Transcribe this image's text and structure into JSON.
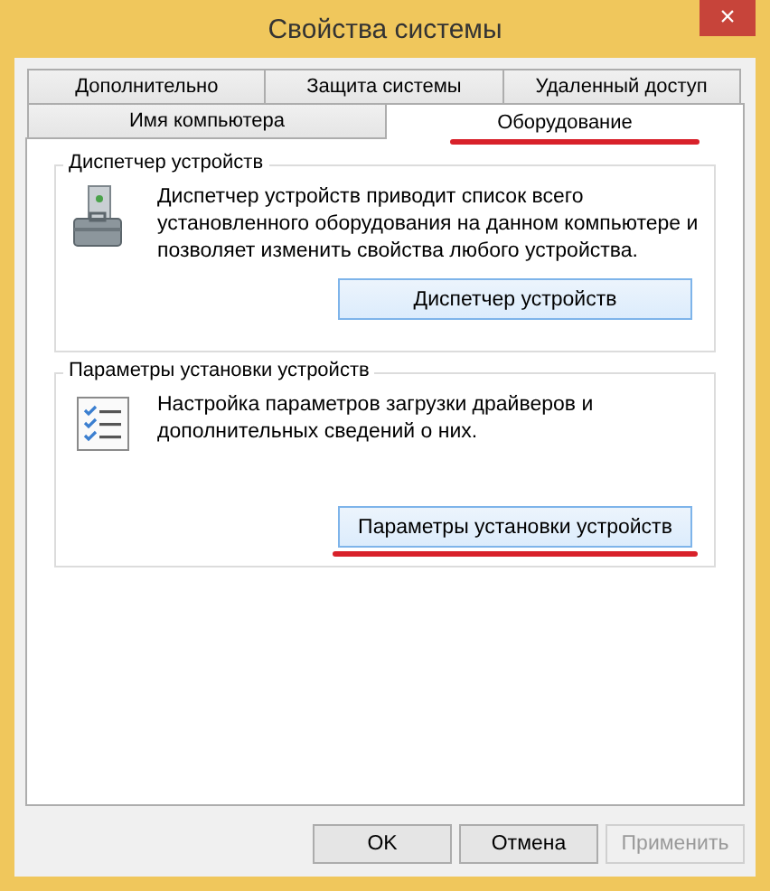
{
  "window": {
    "title": "Свойства системы",
    "close": "×"
  },
  "tab_rows": [
    [
      {
        "label": "Дополнительно",
        "selected": false
      },
      {
        "label": "Защита системы",
        "selected": false
      },
      {
        "label": "Удаленный доступ",
        "selected": false
      }
    ],
    [
      {
        "label": "Имя компьютера",
        "selected": false
      },
      {
        "label": "Оборудование",
        "selected": true,
        "annotated": true
      }
    ]
  ],
  "groups": [
    {
      "title": "Диспетчер устройств",
      "kind": "device-manager",
      "text": "Диспетчер устройств приводит список всего установленного оборудования на данном компьютере и позволяет изменить свойства любого устройства.",
      "button": {
        "label": "Диспетчер устройств"
      }
    },
    {
      "title": "Параметры установки устройств",
      "kind": "install-settings",
      "text": "Настройка параметров загрузки драйверов и дополнительных сведений о них.",
      "button": {
        "label": "Параметры установки устройств",
        "annotated": true
      }
    }
  ],
  "buttons": [
    {
      "label": "OK",
      "disabled": false
    },
    {
      "label": "Отмена",
      "disabled": false
    },
    {
      "label": "Применить",
      "disabled": true
    }
  ]
}
